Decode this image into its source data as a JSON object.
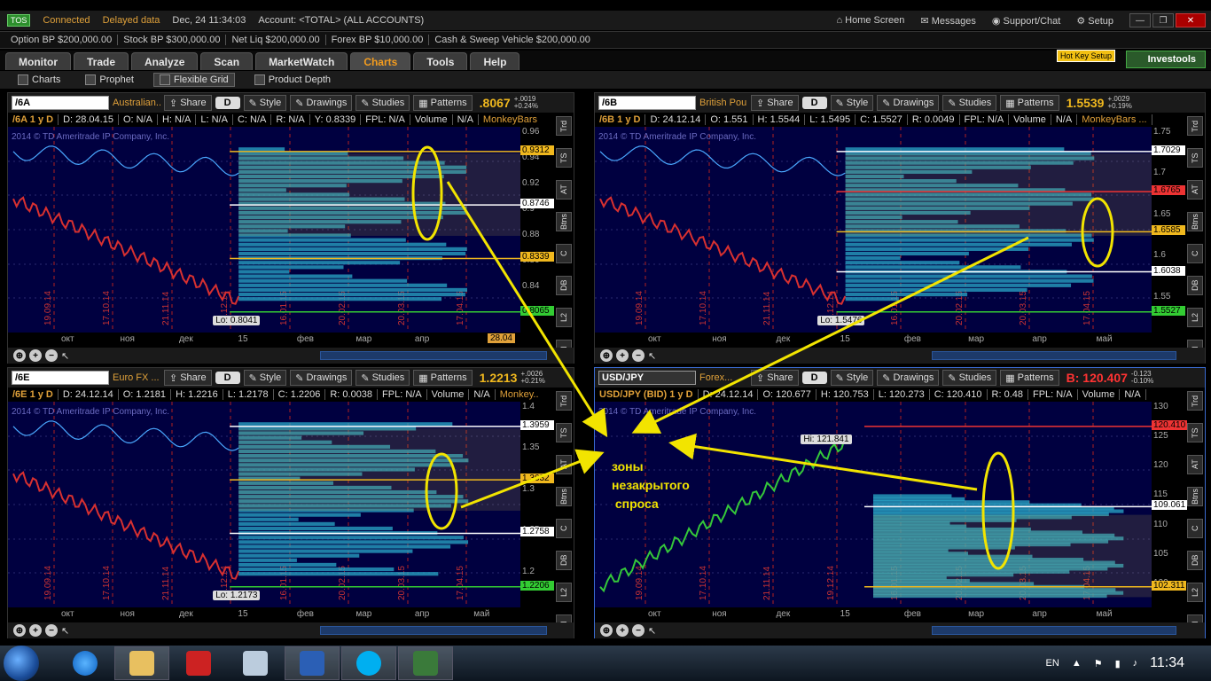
{
  "titlebar": {
    "logo": "TOS",
    "connected": "Connected",
    "delayed": "Delayed data",
    "datetime": "Dec, 24  11:34:03",
    "account": "Account: <TOTAL> (ALL ACCOUNTS)",
    "home": "Home Screen",
    "messages": "Messages",
    "support": "Support/Chat",
    "setup": "Setup",
    "min": "—",
    "max": "❐",
    "close": "✕"
  },
  "bp": [
    "Option BP",
    "$200,000.00",
    "Stock BP",
    "$300,000.00",
    "Net Liq",
    "$200,000.00",
    "Forex BP",
    "$10,000.00",
    "Cash & Sweep Vehicle",
    "$200,000.00"
  ],
  "tabs": [
    "Monitor",
    "Trade",
    "Analyze",
    "Scan",
    "MarketWatch",
    "Charts",
    "Tools",
    "Help"
  ],
  "active_tab": "Charts",
  "hotkey": "Hot Key Setup",
  "investools": "Investools",
  "subtabs": [
    "Charts",
    "Prophet",
    "Flexible Grid",
    "Product Depth"
  ],
  "toolbar": {
    "share": "Share",
    "style": "Style",
    "drawings": "Drawings",
    "studies": "Studies",
    "patterns": "Patterns",
    "d": "D"
  },
  "vtabs": [
    "Trd",
    "TS",
    "AT",
    "Btns",
    "C",
    "DB",
    "L2",
    "N"
  ],
  "annotation": "зоны\nнезакрытого\n спроса",
  "copyright": "2014 © TD Ameritrade IP Company, Inc.",
  "panels": [
    {
      "symbol": "/6A",
      "name": "Australian...",
      "price": ".8067",
      "chg": "+.0019\n+0.24%",
      "info": [
        "/6A 1 y D",
        "D: 28.04.15",
        "O: N/A",
        "H: N/A",
        "L: N/A",
        "C: N/A",
        "R: N/A",
        "Y: 0.8339",
        "FPL: N/A",
        "Volume",
        "N/A",
        "MonkeyBars ..."
      ],
      "axis": [
        "0.96",
        "0.94",
        "0.92",
        "0.9",
        "0.88",
        "0.86",
        "0.84",
        "0.82"
      ],
      "labels": [
        {
          "t": "0.9312",
          "c": "#f0b81e"
        },
        {
          "t": "0.8746",
          "c": "#fff"
        },
        {
          "t": "0.8339",
          "c": "#f0b81e"
        },
        {
          "t": "0.8065",
          "c": "#3c3"
        }
      ],
      "low": "Lo: 0.8041",
      "months": [
        "окт",
        "ноя",
        "дек",
        "15",
        "фев",
        "мар",
        "апр"
      ],
      "datebox": "28.04",
      "vdates": [
        "19.09.14",
        "17.10.14",
        "21.11.14",
        "19.12.14",
        "16.01.15",
        "20.02.15",
        "20.03.15",
        "17.04.15"
      ]
    },
    {
      "symbol": "/6B",
      "name": "British Pound ...",
      "price": "1.5539",
      "chg": "+.0029\n+0.19%",
      "info": [
        "/6B 1 y D",
        "D: 24.12.14",
        "O: 1.551",
        "H: 1.5544",
        "L: 1.5495",
        "C: 1.5527",
        "R: 0.0049",
        "FPL: N/A",
        "Volume",
        "N/A",
        "MonkeyBars ..."
      ],
      "axis": [
        "1.75",
        "1.7",
        "1.65",
        "1.6",
        "1.55"
      ],
      "labels": [
        {
          "t": "1.7029",
          "c": "#fff"
        },
        {
          "t": "1.6765",
          "c": "#e33"
        },
        {
          "t": "1.6585",
          "c": "#f0b81e"
        },
        {
          "t": "1.6038",
          "c": "#fff"
        },
        {
          "t": "1.5527",
          "c": "#3c3"
        }
      ],
      "low": "Lo: 1.5476",
      "months": [
        "окт",
        "ноя",
        "дек",
        "15",
        "фев",
        "мар",
        "апр",
        "май"
      ],
      "datebox": "",
      "vdates": [
        "19.09.14",
        "17.10.14",
        "21.11.14",
        "19.12.14",
        "16.01.15",
        "20.02.15",
        "20.03.15",
        "17.04.15"
      ]
    },
    {
      "symbol": "/6E",
      "name": "Euro FX ...",
      "price": "1.2213",
      "chg": "+.0026\n+0.21%",
      "info": [
        "/6E 1 y D",
        "D: 24.12.14",
        "O: 1.2181",
        "H: 1.2216",
        "L: 1.2178",
        "C: 1.2206",
        "R: 0.0038",
        "FPL: N/A",
        "Volume",
        "N/A",
        "Monkey..."
      ],
      "axis": [
        "1.4",
        "1.35",
        "1.3",
        "1.25",
        "1.2"
      ],
      "labels": [
        {
          "t": "1.3959",
          "c": "#fff"
        },
        {
          "t": "1.3632",
          "c": "#f0b81e"
        },
        {
          "t": "1.2758",
          "c": "#fff"
        },
        {
          "t": "1.2206",
          "c": "#3c3"
        }
      ],
      "low": "Lo: 1.2173",
      "months": [
        "окт",
        "ноя",
        "дек",
        "15",
        "фев",
        "мар",
        "апр",
        "май"
      ],
      "datebox": "",
      "vdates": [
        "19.09.14",
        "17.10.14",
        "21.11.14",
        "19.12.14",
        "16.01.15",
        "20.02.15",
        "20.03.15",
        "17.04.15"
      ]
    },
    {
      "symbol": "USD/JPY",
      "name": "Forex...",
      "price": "B: 120.407",
      "chg": "-0.123\n-0.10%",
      "info": [
        "USD/JPY (BID) 1 y D",
        "D: 24.12.14",
        "O: 120.677",
        "H: 120.753",
        "L: 120.273",
        "C: 120.410",
        "R: 0.48",
        "FPL: N/A",
        "Volume",
        "N/A"
      ],
      "axis": [
        "130",
        "125",
        "120",
        "115",
        "110",
        "105",
        "100"
      ],
      "labels": [
        {
          "t": "120.410",
          "c": "#e33"
        },
        {
          "t": "109.061",
          "c": "#fff"
        },
        {
          "t": "102.311",
          "c": "#f0b81e"
        }
      ],
      "high": "Hi: 121.841",
      "months": [
        "окт",
        "ноя",
        "дек",
        "15",
        "фев",
        "мар",
        "апр",
        "май"
      ],
      "datebox": "",
      "vdates": [
        "19.09.14",
        "17.10.14",
        "21.11.14",
        "19.12.14",
        "16.01.15",
        "20.02.15",
        "20.03.15",
        "17.04.15"
      ]
    }
  ],
  "taskbar": {
    "lang": "EN",
    "clock": "11:34"
  }
}
